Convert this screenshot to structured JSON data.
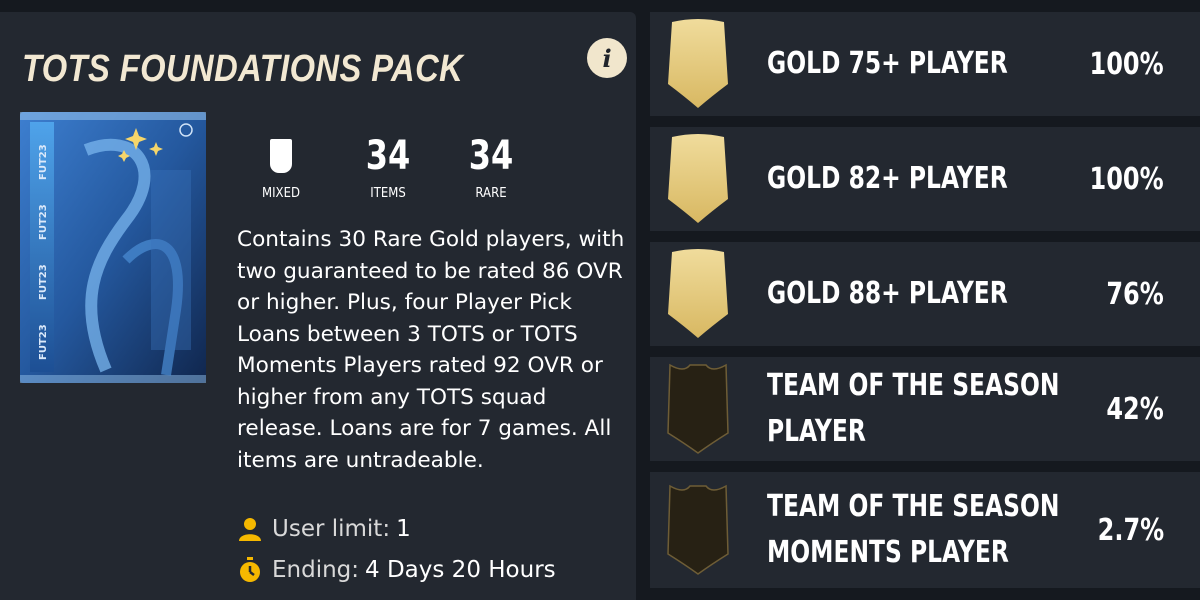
{
  "pack": {
    "title": "TOTS FOUNDATIONS PACK",
    "info_icon": "i",
    "art_branding": "FUT23",
    "stats": [
      {
        "value": "",
        "label": "MIXED",
        "icon": "card-icon"
      },
      {
        "value": "34",
        "label": "ITEMS"
      },
      {
        "value": "34",
        "label": "RARE"
      }
    ],
    "description": "Contains 30 Rare Gold players, with two guaranteed to be rated 86 OVR or higher. Plus, four Player Pick Loans between 3 TOTS or TOTS Moments Players rated 92 OVR or higher from any TOTS squad release. Loans are for 7 games. All items are untradeable.",
    "user_limit_label": "User limit:",
    "user_limit_value": "1",
    "ending_label": "Ending:",
    "ending_value": "4 Days 20 Hours"
  },
  "colors": {
    "panel": "#232830",
    "background": "#15191f",
    "gold": "#e9cf86",
    "accent_yellow": "#f5b800",
    "tots_card": "#2a2419"
  },
  "rewards": [
    {
      "name": "GOLD 75+ PLAYER",
      "percent": "100%",
      "card": "gold"
    },
    {
      "name": "GOLD 82+ PLAYER",
      "percent": "100%",
      "card": "gold"
    },
    {
      "name": "GOLD 88+ PLAYER",
      "percent": "76%",
      "card": "gold"
    },
    {
      "name": "TEAM OF THE SEASON\nPLAYER",
      "percent": "42%",
      "card": "tots"
    },
    {
      "name": "TEAM OF THE SEASON\nMOMENTS PLAYER",
      "percent": "2.7%",
      "card": "tots"
    }
  ]
}
